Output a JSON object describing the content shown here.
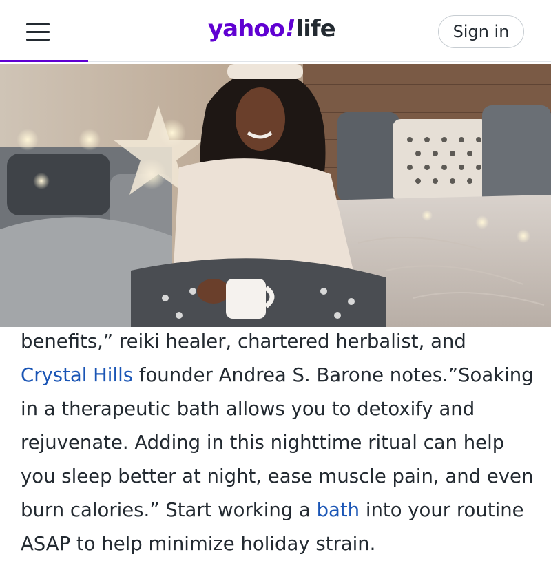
{
  "header": {
    "menu_icon": "hamburger-menu-icon",
    "logo": {
      "brand": "yahoo",
      "slash": "!",
      "section": "life"
    },
    "signin_label": "Sign in",
    "reading_progress": 0.16,
    "accent_color": "#6001d2"
  },
  "hero": {
    "image_content": "woman-in-sweater-holding-mug-on-bed-photo"
  },
  "article": {
    "p1_a": "benefits,” reiki healer, chartered herbalist, and ",
    "link_crystal": "Crystal Hills",
    "p1_b": " founder Andrea S. Barone notes.”Soaking in a therapeutic bath allows you to detoxify and rejuvenate. Adding in this nighttime ritual can help you sleep better at night, ease muscle pain, and even burn calories.” Start working a ",
    "link_bath": "bath",
    "p1_c": " into your routine ASAP to help minimize holiday strain.",
    "link_color": "#1a55b5"
  }
}
